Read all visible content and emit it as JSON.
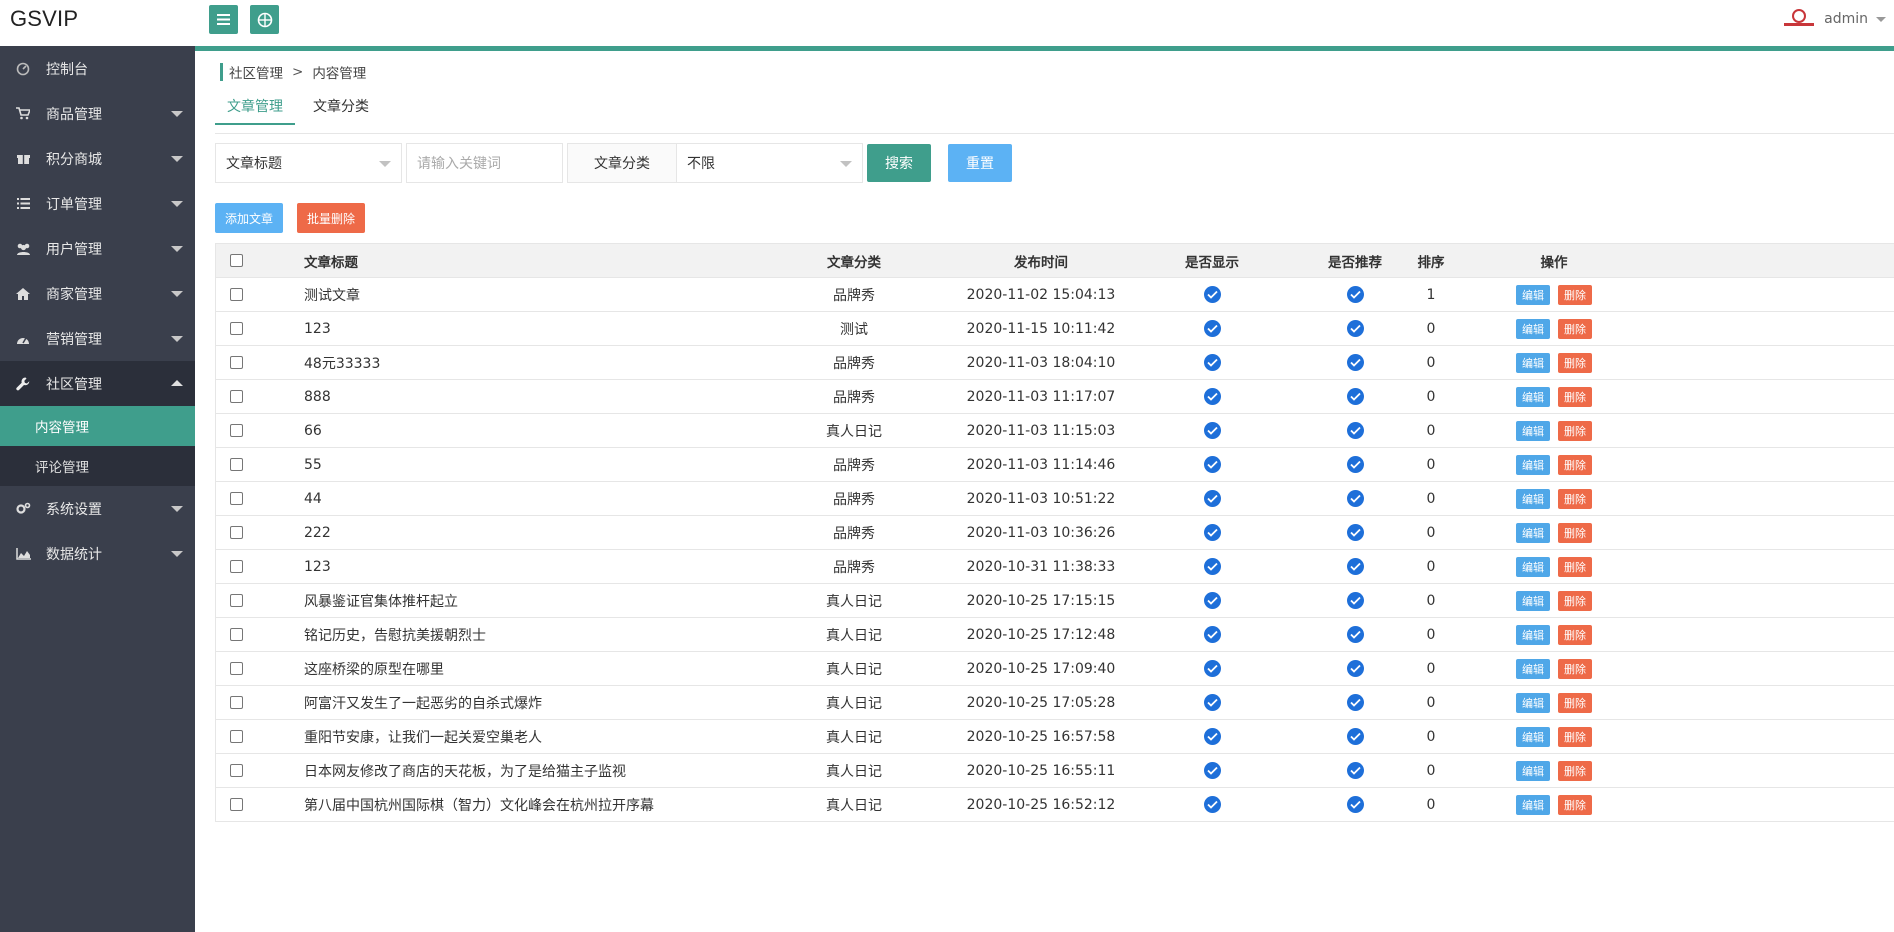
{
  "app": {
    "brand": "GSVIP",
    "user": "admin"
  },
  "sidebar": {
    "items": [
      {
        "label": "控制台",
        "icon": "dashboard-icon"
      },
      {
        "label": "商品管理",
        "icon": "cart-icon"
      },
      {
        "label": "积分商城",
        "icon": "gift-icon"
      },
      {
        "label": "订单管理",
        "icon": "list-icon"
      },
      {
        "label": "用户管理",
        "icon": "users-icon"
      },
      {
        "label": "商家管理",
        "icon": "home-icon"
      },
      {
        "label": "营销管理",
        "icon": "gauge-icon"
      },
      {
        "label": "社区管理",
        "icon": "wrench-icon"
      },
      {
        "label": "系统设置",
        "icon": "cogs-icon"
      },
      {
        "label": "数据统计",
        "icon": "area-chart-icon"
      }
    ],
    "sub": [
      {
        "label": "内容管理"
      },
      {
        "label": "评论管理"
      }
    ]
  },
  "breadcrumb": {
    "parent": "社区管理",
    "sep": ">",
    "current": "内容管理"
  },
  "tabs": [
    {
      "label": "文章管理"
    },
    {
      "label": "文章分类"
    }
  ],
  "filters": {
    "field_select": "文章标题",
    "keyword_placeholder": "请输入关键词",
    "category_label": "文章分类",
    "category_select": "不限",
    "search_label": "搜索",
    "reset_label": "重置"
  },
  "actions": {
    "add_label": "添加文章",
    "bulk_delete_label": "批量删除"
  },
  "table": {
    "headers": {
      "title": "文章标题",
      "category": "文章分类",
      "time": "发布时间",
      "show": "是否显示",
      "recommend": "是否推荐",
      "sort": "排序",
      "ops": "操作"
    },
    "edit_label": "编辑",
    "delete_label": "删除",
    "rows": [
      {
        "title": "测试文章",
        "category": "品牌秀",
        "time": "2020-11-02 15:04:13",
        "sort": "1"
      },
      {
        "title": "123",
        "category": "测试",
        "time": "2020-11-15 10:11:42",
        "sort": "0"
      },
      {
        "title": "48元33333",
        "category": "品牌秀",
        "time": "2020-11-03 18:04:10",
        "sort": "0"
      },
      {
        "title": "888",
        "category": "品牌秀",
        "time": "2020-11-03 11:17:07",
        "sort": "0"
      },
      {
        "title": "66",
        "category": "真人日记",
        "time": "2020-11-03 11:15:03",
        "sort": "0"
      },
      {
        "title": "55",
        "category": "品牌秀",
        "time": "2020-11-03 11:14:46",
        "sort": "0"
      },
      {
        "title": "44",
        "category": "品牌秀",
        "time": "2020-11-03 10:51:22",
        "sort": "0"
      },
      {
        "title": "222",
        "category": "品牌秀",
        "time": "2020-11-03 10:36:26",
        "sort": "0"
      },
      {
        "title": "123",
        "category": "品牌秀",
        "time": "2020-10-31 11:38:33",
        "sort": "0"
      },
      {
        "title": "风暴鉴证官集体推杆起立",
        "category": "真人日记",
        "time": "2020-10-25 17:15:15",
        "sort": "0"
      },
      {
        "title": "铭记历史，告慰抗美援朝烈士",
        "category": "真人日记",
        "time": "2020-10-25 17:12:48",
        "sort": "0"
      },
      {
        "title": "这座桥梁的原型在哪里",
        "category": "真人日记",
        "time": "2020-10-25 17:09:40",
        "sort": "0"
      },
      {
        "title": "阿富汗又发生了一起恶劣的自杀式爆炸",
        "category": "真人日记",
        "time": "2020-10-25 17:05:28",
        "sort": "0"
      },
      {
        "title": "重阳节安康，让我们一起关爱空巢老人",
        "category": "真人日记",
        "time": "2020-10-25 16:57:58",
        "sort": "0"
      },
      {
        "title": "日本网友修改了商店的天花板，为了是给猫主子监视",
        "category": "真人日记",
        "time": "2020-10-25 16:55:11",
        "sort": "0"
      },
      {
        "title": "第八届中国杭州国际棋（智力）文化峰会在杭州拉开序幕",
        "category": "真人日记",
        "time": "2020-10-25 16:52:12",
        "sort": "0"
      }
    ]
  }
}
